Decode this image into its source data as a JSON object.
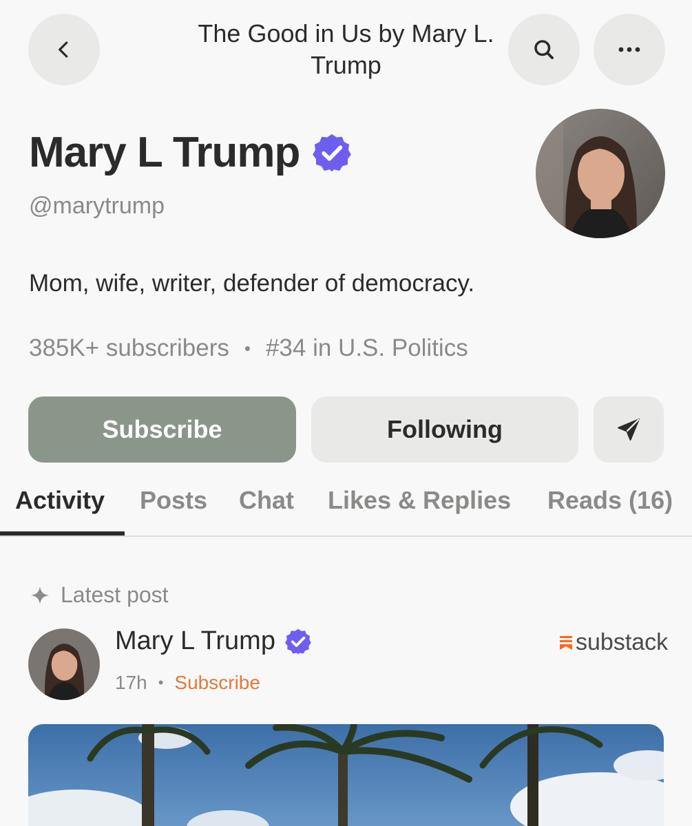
{
  "header": {
    "title": "The Good in Us by Mary L. Trump",
    "back_icon": "chevron-left-icon",
    "search_icon": "search-icon",
    "more_icon": "more-horizontal-icon"
  },
  "profile": {
    "name": "Mary L Trump",
    "handle": "@marytrump",
    "bio": "Mom, wife, writer, defender of democracy.",
    "subscribers": "385K+ subscribers",
    "ranking": "#34 in U.S. Politics",
    "verified": true
  },
  "actions": {
    "subscribe_label": "Subscribe",
    "following_label": "Following",
    "send_icon": "send-icon"
  },
  "tabs": [
    {
      "label": "Activity",
      "active": true
    },
    {
      "label": "Posts",
      "active": false
    },
    {
      "label": "Chat",
      "active": false
    },
    {
      "label": "Likes & Replies",
      "active": false
    },
    {
      "label": "Reads (16)",
      "active": false
    }
  ],
  "latest_post": {
    "section_label": "Latest post",
    "author": "Mary L Trump",
    "time": "17h",
    "subscribe_link": "Subscribe",
    "brand": "substack"
  },
  "colors": {
    "accent_verified": "#6e5ef0",
    "subscribe_button": "#8b968a",
    "link_orange": "#e07a3a",
    "substack_orange": "#ff6719"
  }
}
